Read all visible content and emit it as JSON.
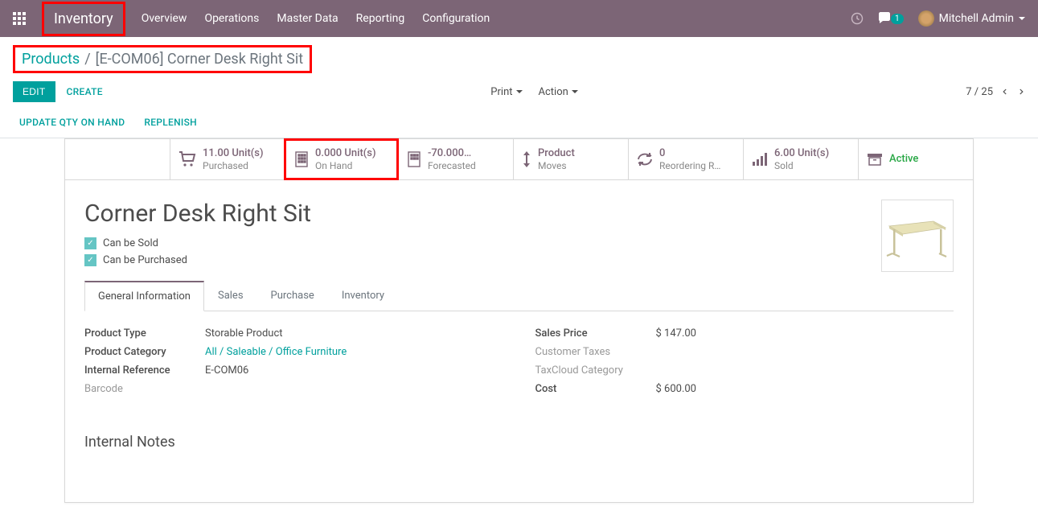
{
  "navbar": {
    "brand": "Inventory",
    "menu": [
      "Overview",
      "Operations",
      "Master Data",
      "Reporting",
      "Configuration"
    ],
    "chat_badge": "1",
    "user": "Mitchell Admin"
  },
  "breadcrumb": {
    "parent": "Products",
    "current": "[E-COM06] Corner Desk Right Sit"
  },
  "buttons": {
    "edit": "Edit",
    "create": "Create",
    "print": "Print",
    "action": "Action",
    "update_qty": "Update Qty On Hand",
    "replenish": "Replenish"
  },
  "pager": {
    "text": "7 / 25"
  },
  "stats": {
    "purchased": {
      "value": "11.00 Unit(s)",
      "label": "Purchased"
    },
    "on_hand": {
      "value": "0.000 Unit(s)",
      "label": "On Hand"
    },
    "forecasted": {
      "value": "-70.000…",
      "label": "Forecasted"
    },
    "moves": {
      "value": "Product",
      "label": "Moves"
    },
    "reorder": {
      "value": "0",
      "label": "Reordering R…"
    },
    "sold": {
      "value": "6.00 Unit(s)",
      "label": "Sold"
    },
    "active": {
      "value": "Active"
    }
  },
  "product": {
    "name": "Corner Desk Right Sit",
    "can_be_sold": "Can be Sold",
    "can_be_purchased": "Can be Purchased"
  },
  "tabs": [
    "General Information",
    "Sales",
    "Purchase",
    "Inventory"
  ],
  "fields": {
    "product_type": {
      "label": "Product Type",
      "value": "Storable Product"
    },
    "category": {
      "label": "Product Category",
      "value": "All / Saleable / Office Furniture"
    },
    "internal_ref": {
      "label": "Internal Reference",
      "value": "E-COM06"
    },
    "barcode": {
      "label": "Barcode",
      "value": ""
    },
    "sales_price": {
      "label": "Sales Price",
      "value": "$ 147.00"
    },
    "customer_tax": {
      "label": "Customer Taxes",
      "value": ""
    },
    "taxcloud": {
      "label": "TaxCloud Category",
      "value": ""
    },
    "cost": {
      "label": "Cost",
      "value": "$ 600.00"
    }
  },
  "internal_notes_heading": "Internal Notes"
}
